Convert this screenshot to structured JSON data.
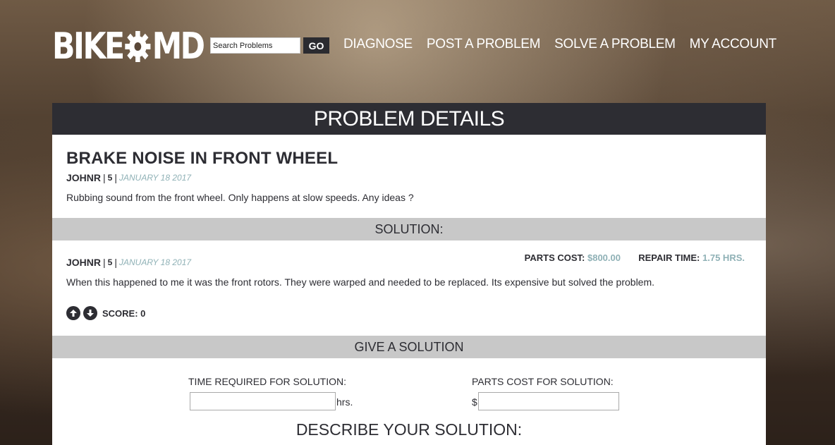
{
  "header": {
    "logo_left": "BIKE",
    "logo_right": "MD",
    "search_placeholder": "Search Problems",
    "go_label": "GO",
    "nav": [
      "DIAGNOSE",
      "POST A PROBLEM",
      "SOLVE A PROBLEM",
      "MY ACCOUNT"
    ]
  },
  "panel": {
    "title": "PROBLEM DETAILS",
    "problem": {
      "title": "BRAKE NOISE IN FRONT WHEEL",
      "user": "JOHNR",
      "count": "5",
      "date": "JANUARY 18 2017",
      "description": "Rubbing sound from the front wheel. Only happens at slow speeds. Any ideas ?"
    },
    "solution_header": "SOLUTION:",
    "solution": {
      "user": "JOHNR",
      "count": "5",
      "date": "JANUARY 18 2017",
      "parts_cost_label": "PARTS COST:",
      "parts_cost_value": "$800.00",
      "repair_time_label": "REPAIR TIME:",
      "repair_time_value": "1.75 HRS.",
      "description": "When this happened to me it was the front rotors. They were warped and needed to be replaced. Its expensive but solved the problem.",
      "score_label": "SCORE: 0"
    },
    "give_header": "GIVE A SOLUTION",
    "form": {
      "time_label": "TIME REQUIRED FOR SOLUTION:",
      "time_value": "",
      "time_unit": "hrs.",
      "parts_label": "PARTS COST FOR SOLUTION:",
      "parts_value": "",
      "currency": "$",
      "describe_title": "DESCRIBE YOUR SOLUTION:"
    }
  },
  "colors": {
    "dark": "#2d2d33",
    "accent": "#8fb1b6",
    "bar": "#c8c8c8"
  }
}
